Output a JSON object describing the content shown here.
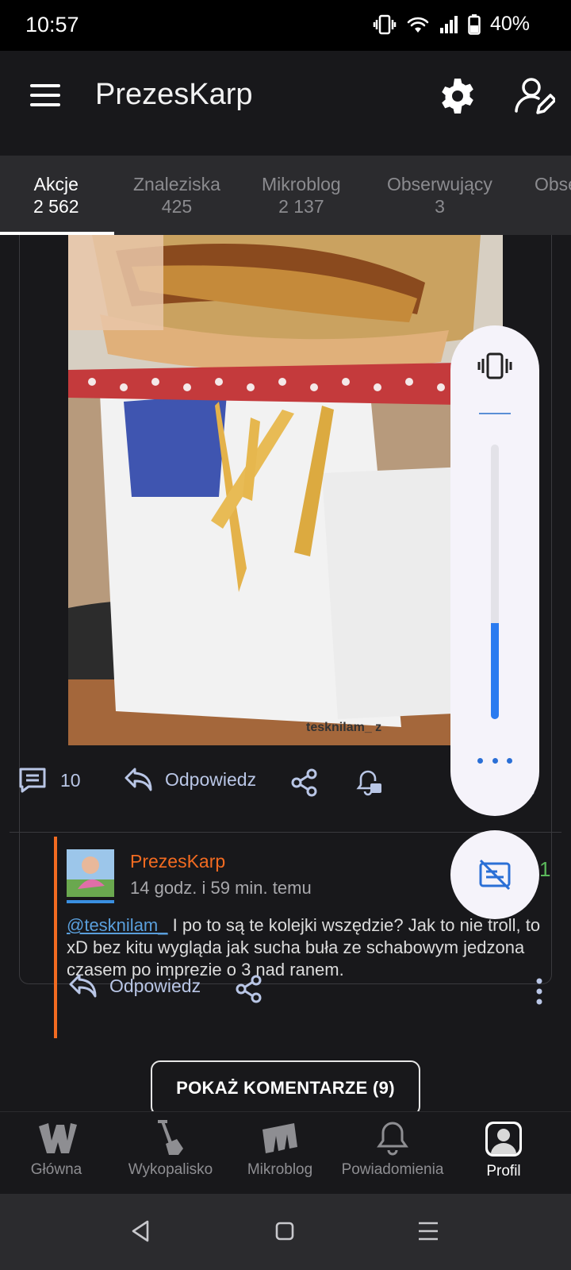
{
  "status": {
    "time": "10:57",
    "battery": "40%"
  },
  "app": {
    "title": "PrezesKarp"
  },
  "tabs": [
    {
      "label": "Akcje",
      "count": "2 562"
    },
    {
      "label": "Znaleziska",
      "count": "425"
    },
    {
      "label": "Mikroblog",
      "count": "2 137"
    },
    {
      "label": "Obserwujący",
      "count": "3"
    },
    {
      "label": "Obse",
      "count": ""
    }
  ],
  "post": {
    "image_caption": "tesknilam_ z",
    "comments_count": "10",
    "reply_label": "Odpowiedz"
  },
  "comment": {
    "author": "PrezesKarp",
    "time": "14 godz. i 59 min. temu",
    "score": "1",
    "mention": "@tesknilam_",
    "text": " I po to są te kolejki wszędzie? Jak to nie troll, to xD bez kitu wygląda jak sucha buła ze schabowym jedzona czasem po imprezie o 3 nad ranem.",
    "reply_label": "Odpowiedz"
  },
  "show_comments_label": "POKAŻ KOMENTARZE (9)",
  "volume": {
    "level": 0.35
  },
  "bottom_nav": [
    {
      "label": "Główna",
      "icon": "wykop-logo-icon"
    },
    {
      "label": "Wykopalisko",
      "icon": "shovel-icon"
    },
    {
      "label": "Mikroblog",
      "icon": "mikroblog-logo-icon"
    },
    {
      "label": "Powiadomienia",
      "icon": "bell-icon"
    },
    {
      "label": "Profil",
      "icon": "profile-icon"
    }
  ]
}
